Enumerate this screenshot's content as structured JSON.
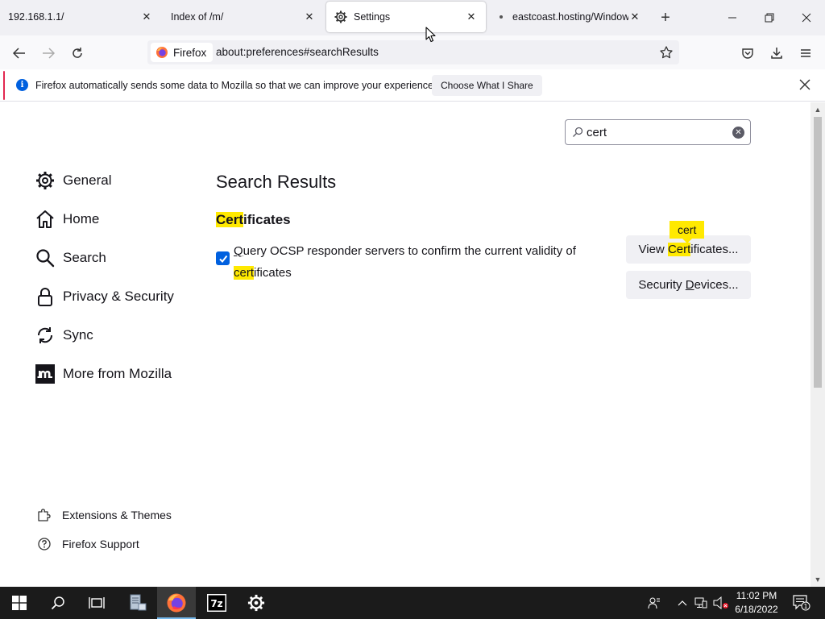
{
  "tabs": [
    {
      "title": "192.168.1.1/",
      "active": false
    },
    {
      "title": "Index of /m/",
      "active": false
    },
    {
      "title": "Settings",
      "active": true
    },
    {
      "title": "eastcoast.hosting/Windows",
      "active": false
    }
  ],
  "navbar": {
    "identity_label": "Firefox",
    "url": "about:preferences#searchResults"
  },
  "notification": {
    "message": "Firefox automatically sends some data to Mozilla so that we can improve your experience.",
    "button_label": "Choose What I Share"
  },
  "search": {
    "value": "cert"
  },
  "sidebar": {
    "items": [
      {
        "label": "General",
        "icon": "gear-icon"
      },
      {
        "label": "Home",
        "icon": "home-icon"
      },
      {
        "label": "Search",
        "icon": "search-icon"
      },
      {
        "label": "Privacy & Security",
        "icon": "lock-icon"
      },
      {
        "label": "Sync",
        "icon": "sync-icon"
      },
      {
        "label": "More from Mozilla",
        "icon": "mozilla-icon"
      }
    ],
    "footer": [
      {
        "label": "Extensions & Themes",
        "icon": "puzzle-icon"
      },
      {
        "label": "Firefox Support",
        "icon": "help-icon"
      }
    ]
  },
  "main": {
    "page_title": "Search Results",
    "section": {
      "title_highlight": "Cert",
      "title_rest": "ificates"
    },
    "ocsp": {
      "checked": true,
      "label_accesskey": "Q",
      "label_part1": "uery OCSP responder servers to confirm the current validity of ",
      "label_highlight": "cert",
      "label_part2": "ificates"
    },
    "view_certificates": {
      "prefix": "View ",
      "highlight": "Cert",
      "suffix": "ificates..."
    },
    "security_devices": {
      "prefix": "Security ",
      "accesskey": "D",
      "suffix": "evices..."
    },
    "tooltip": "cert"
  },
  "taskbar": {
    "time": "11:02 PM",
    "date": "6/18/2022"
  },
  "colors": {
    "highlight": "#ffe900",
    "checkbox": "#0060df",
    "notification_accent": "#e22850"
  }
}
